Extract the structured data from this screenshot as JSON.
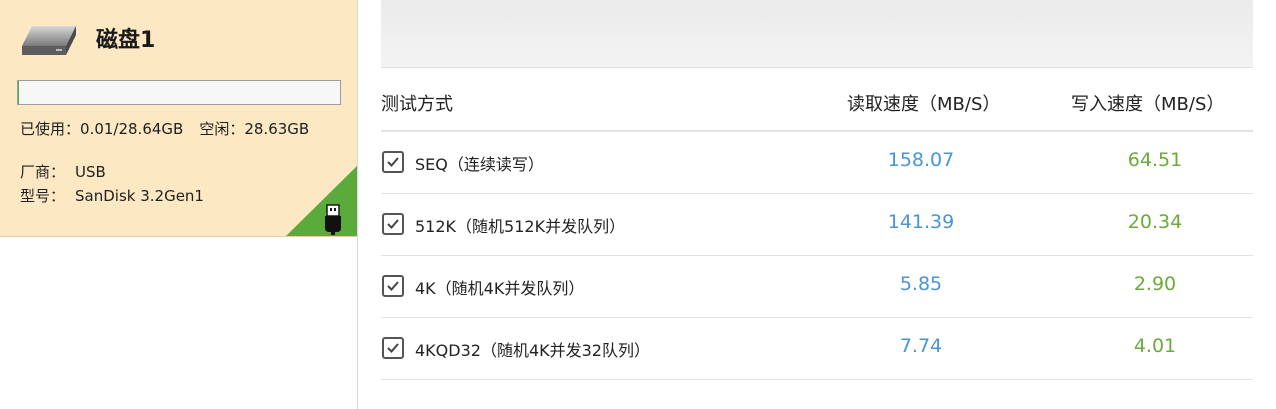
{
  "disk": {
    "name": "磁盘1",
    "usage_fraction": 0.0003,
    "used_label": "已使用：",
    "used_value": "0.01/28.64GB",
    "free_label": "空闲：",
    "free_value": "28.63GB",
    "vendor_label": "厂商：",
    "vendor_value": "USB",
    "model_label": "型号：",
    "model_value": "SanDisk 3.2Gen1",
    "interface_icon": "usb-icon",
    "colors": {
      "card_bg": "#fce8c3",
      "corner": "#5aab3c"
    }
  },
  "table": {
    "headers": {
      "method": "测试方式",
      "read": "读取速度（MB/S）",
      "write": "写入速度（MB/S）"
    },
    "rows": [
      {
        "label": "SEQ（连续读写）",
        "read": "158.07",
        "write": "64.51",
        "checked": true
      },
      {
        "label": "512K（随机512K并发队列）",
        "read": "141.39",
        "write": "20.34",
        "checked": true
      },
      {
        "label": "4K（随机4K并发队列）",
        "read": "5.85",
        "write": "2.90",
        "checked": true
      },
      {
        "label": "4KQD32（随机4K并发32队列）",
        "read": "7.74",
        "write": "4.01",
        "checked": true
      }
    ],
    "colors": {
      "read": "#4a95d6",
      "write": "#6aab39"
    }
  }
}
